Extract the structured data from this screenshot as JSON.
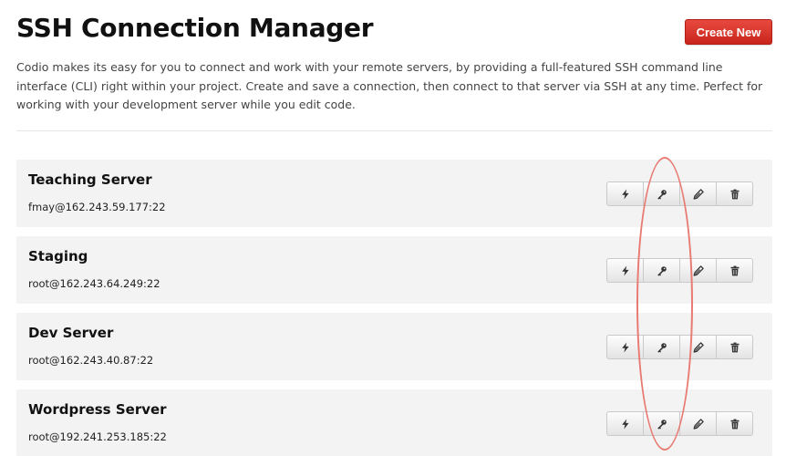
{
  "header": {
    "title": "SSH Connection Manager",
    "create_label": "Create New"
  },
  "description": "Codio makes its easy for you to connect and work with your remote servers, by providing a full-featured SSH command line interface (CLI) right within your project. Create and save a connection, then connect to that server via SSH at any time. Perfect for working with your development server while you edit code.",
  "servers": [
    {
      "name": "Teaching Server",
      "address": "fmay@162.243.59.177:22"
    },
    {
      "name": "Staging",
      "address": "root@162.243.64.249:22"
    },
    {
      "name": "Dev Server",
      "address": "root@162.243.40.87:22"
    },
    {
      "name": "Wordpress Server",
      "address": "root@192.241.253.185:22"
    }
  ],
  "actions": [
    {
      "name": "connect",
      "icon": "lightning-icon"
    },
    {
      "name": "key",
      "icon": "key-icon"
    },
    {
      "name": "edit",
      "icon": "pencil-icon"
    },
    {
      "name": "delete",
      "icon": "trash-icon"
    }
  ],
  "colors": {
    "accent": "#d9342a",
    "row_background": "#f3f3f3",
    "highlight": "#e87a72"
  }
}
